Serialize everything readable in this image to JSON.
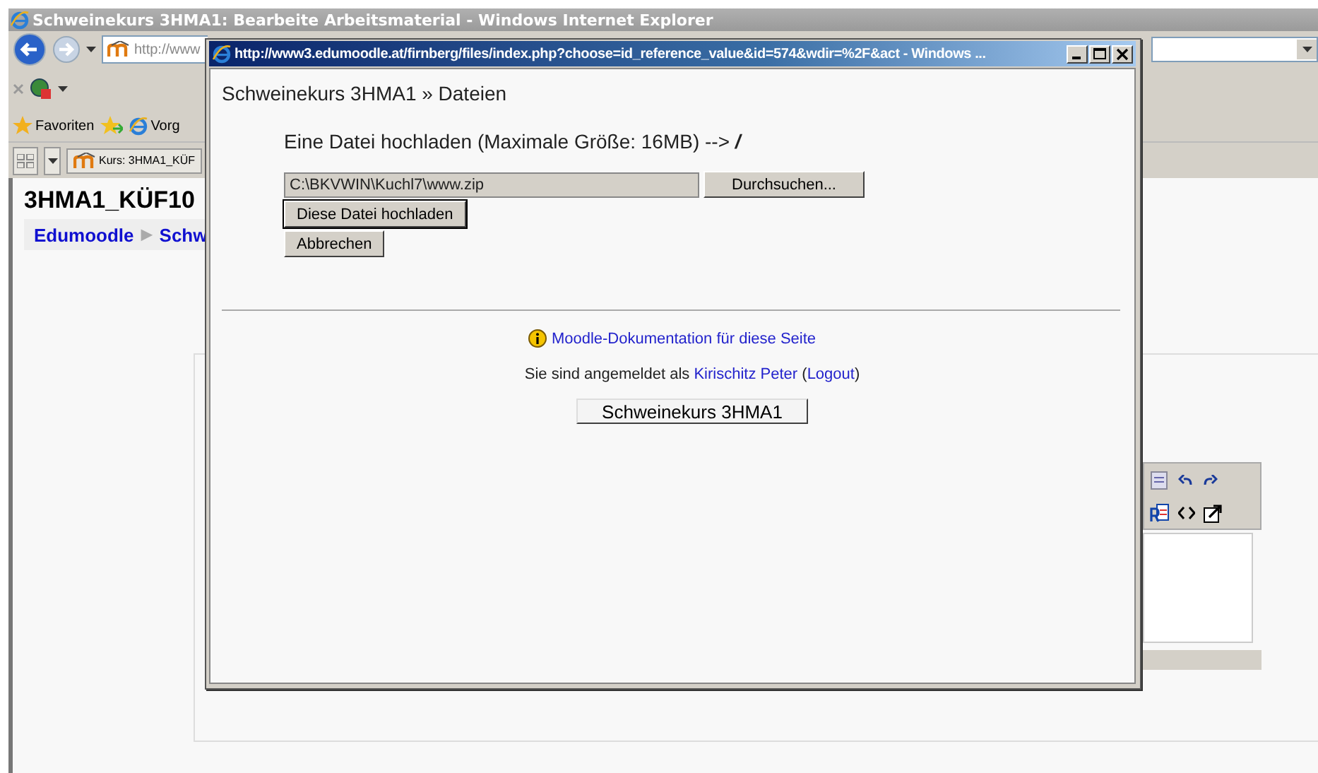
{
  "browser": {
    "title": "Schweinekurs 3HMA1: Bearbeite Arbeitsmaterial - Windows Internet Explorer",
    "address": "http://www",
    "favorites_label": "Favoriten",
    "favorite_link": "Vorg",
    "tab": "Kurs: 3HMA1_KÜF",
    "page_heading": "3HMA1_KÜF10",
    "breadcrumb": {
      "home": "Edumoodle",
      "separator": "▶",
      "course": "Schw"
    }
  },
  "popup": {
    "title": "http://www3.edumoodle.at/firnberg/files/index.php?choose=id_reference_value&id=574&wdir=%2F&act - Windows ...",
    "breadcrumb": "Schweinekurs 3HMA1 » Dateien",
    "upload_heading": "Eine Datei hochladen (Maximale Größe: 16MB) -->",
    "folder": "/",
    "file_path": "C:\\BKVWIN\\Kuchl7\\www.zip",
    "browse_button": "Durchsuchen...",
    "upload_button": "Diese Datei hochladen",
    "cancel_button": "Abbrechen",
    "docs_link": "Moodle-Dokumentation für diese Seite",
    "login": {
      "prefix": "Sie sind angemeldet als",
      "user": "Kirischitz Peter",
      "open_paren": "(",
      "logout": "Logout",
      "close_paren": ")"
    },
    "course_button": "Schweinekurs 3HMA1"
  }
}
